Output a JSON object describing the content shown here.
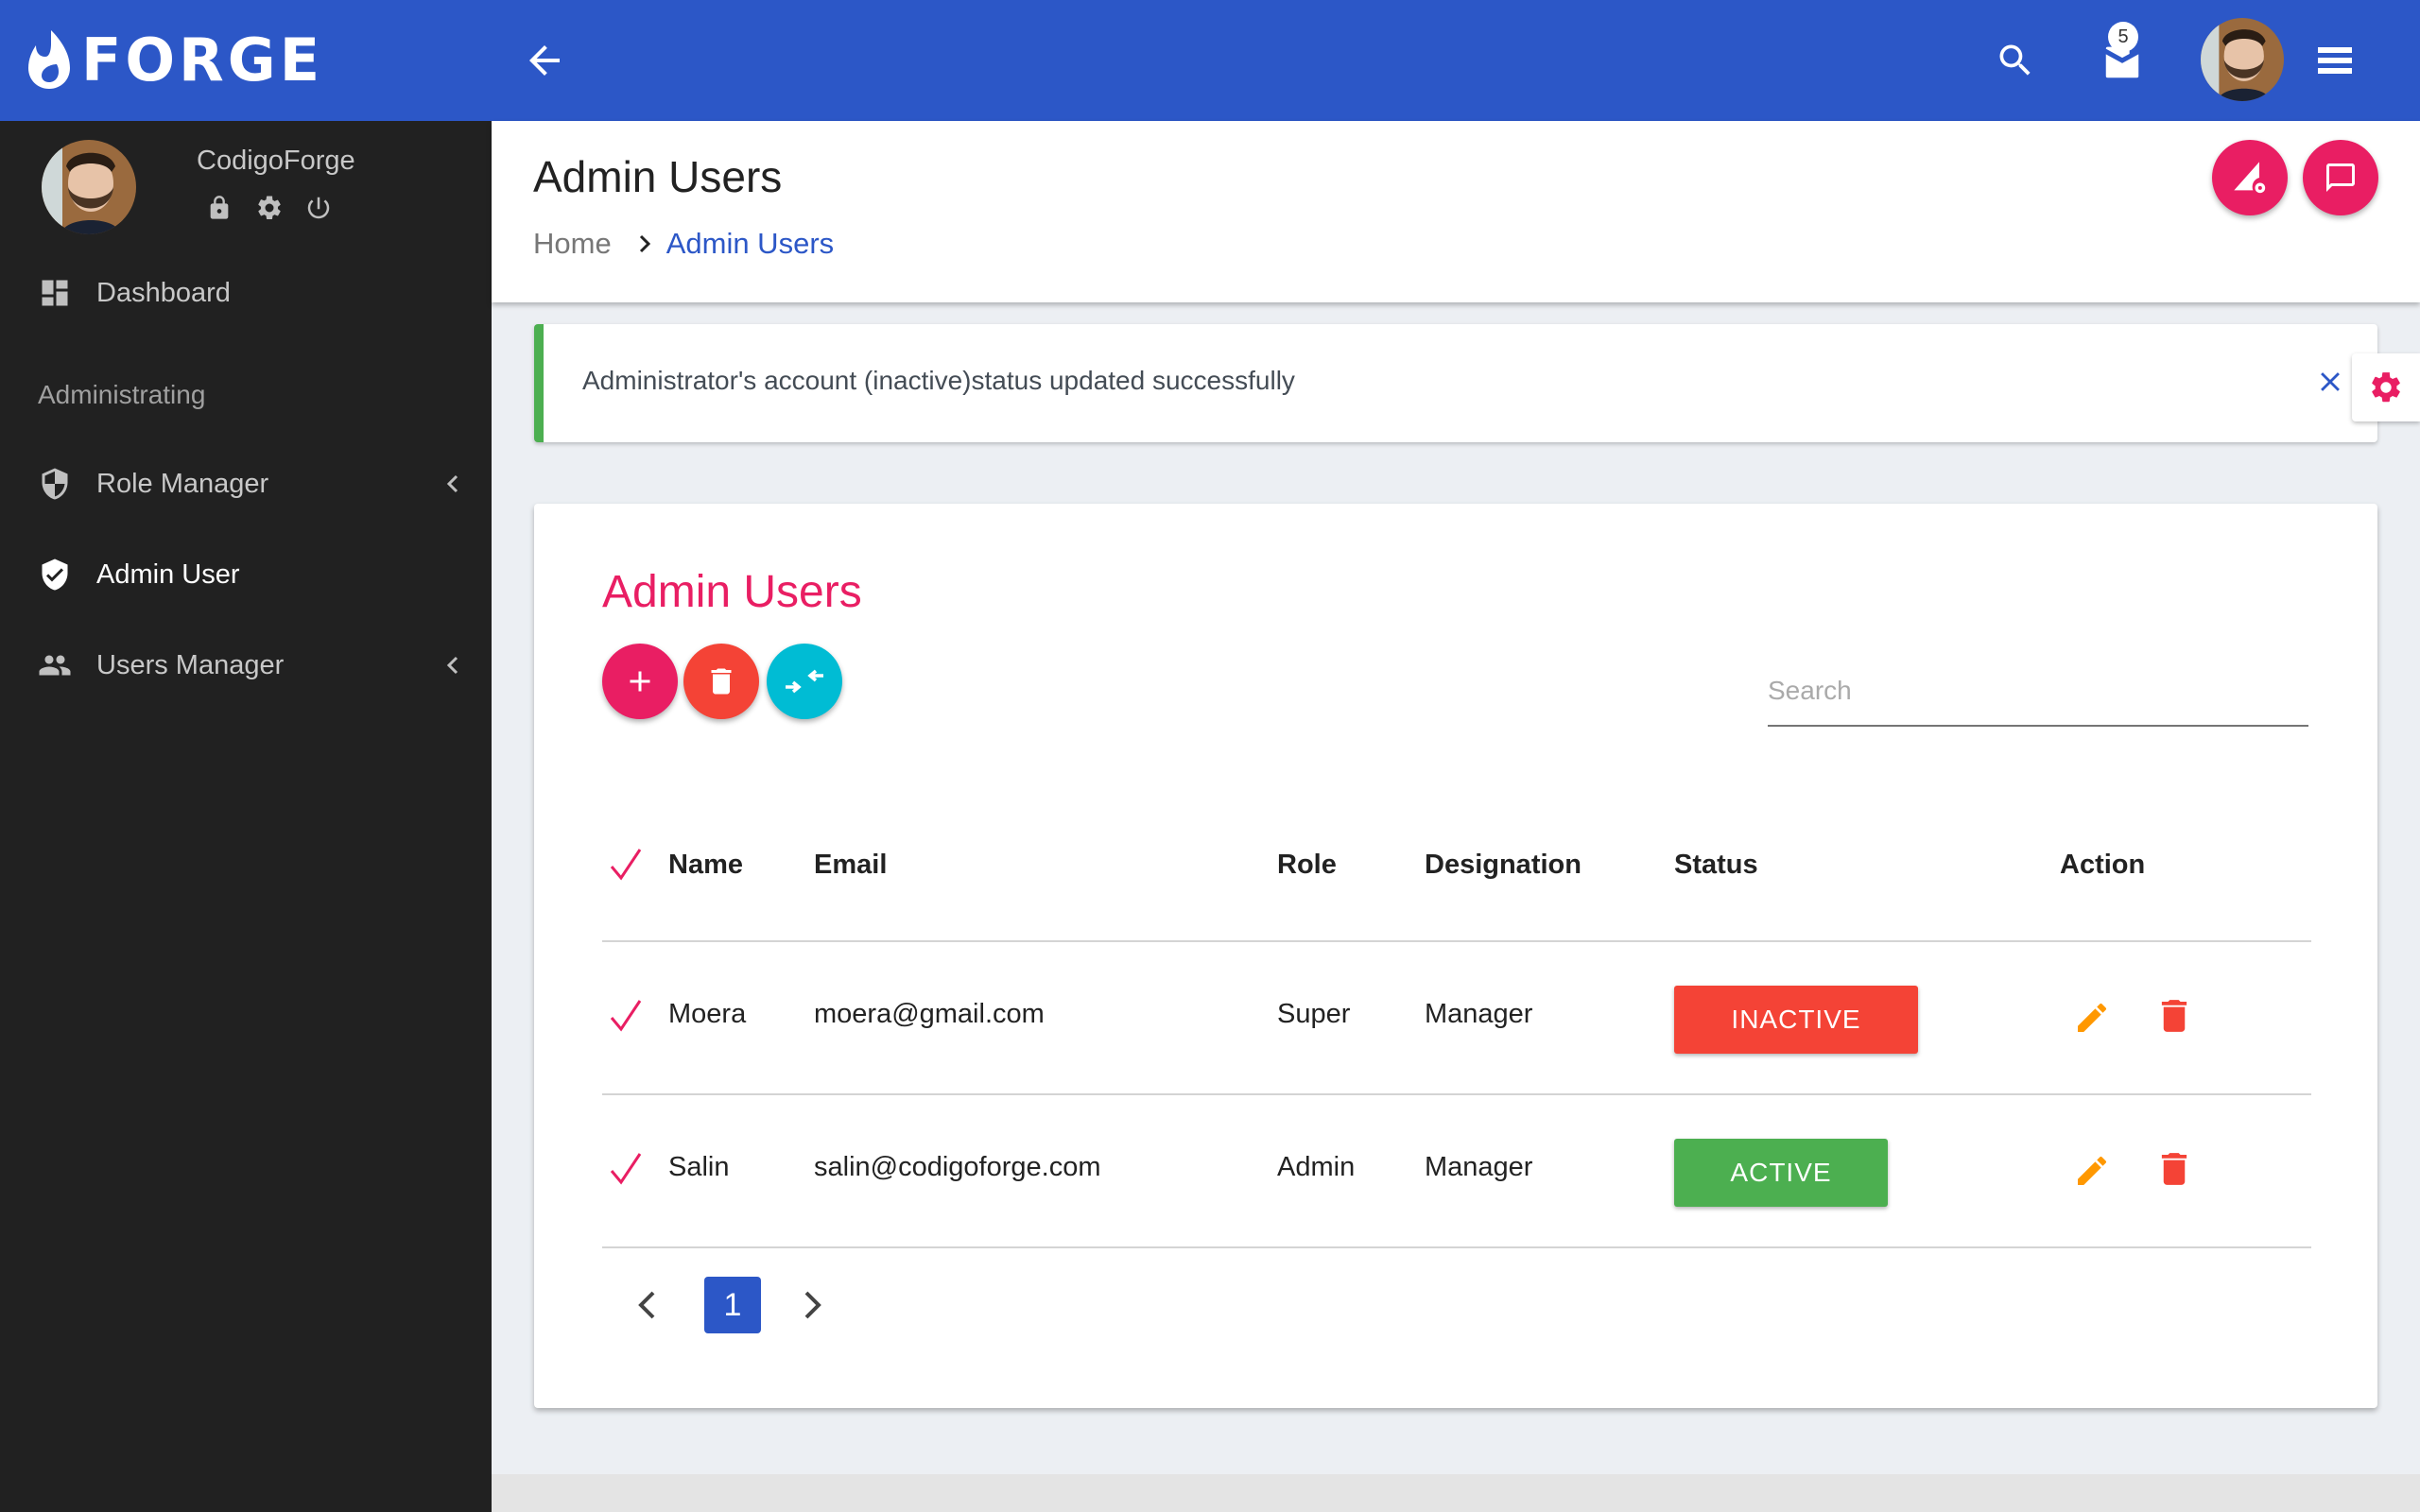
{
  "app": {
    "brand": "FORGE"
  },
  "topbar": {
    "mail_badge_count": "5",
    "icons": [
      "back-arrow-icon",
      "search-icon",
      "mail-icon",
      "avatar",
      "menu-icon"
    ]
  },
  "sidebar": {
    "username": "CodigoForge",
    "user_actions": [
      "lock-icon",
      "gear-icon",
      "power-icon"
    ],
    "section_label": "Administrating",
    "items": [
      {
        "label": "Dashboard",
        "icon": "dashboard-icon",
        "active": false,
        "has_submenu": false
      },
      {
        "label": "Role Manager",
        "icon": "shield-half-icon",
        "active": false,
        "has_submenu": true
      },
      {
        "label": "Admin User",
        "icon": "shield-check-icon",
        "active": true,
        "has_submenu": false
      },
      {
        "label": "Users Manager",
        "icon": "people-icon",
        "active": false,
        "has_submenu": true
      }
    ]
  },
  "page_header": {
    "title": "Admin Users",
    "breadcrumb": {
      "home": "Home",
      "current": "Admin Users"
    }
  },
  "alert": {
    "message": "Administrator's account (inactive)status updated successfully",
    "type": "success"
  },
  "card": {
    "title": "Admin Users",
    "search": {
      "placeholder": "Search",
      "value": ""
    },
    "table": {
      "columns": [
        "Name",
        "Email",
        "Role",
        "Designation",
        "Status",
        "Action"
      ],
      "rows": [
        {
          "name": "Moera",
          "email": "moera@gmail.com",
          "role": "Super",
          "designation": "Manager",
          "status": "INACTIVE"
        },
        {
          "name": "Salin",
          "email": "salin@codigoforge.com",
          "role": "Admin",
          "designation": "Manager",
          "status": "ACTIVE"
        }
      ]
    },
    "pagination": {
      "current_page": "1"
    }
  },
  "colors": {
    "primary": "#2C57C7",
    "accent": "#E91E63",
    "danger": "#F44336",
    "success": "#4CAF50",
    "info": "#00BCD4",
    "warning": "#FF9800",
    "sidebar_bg": "#212121"
  }
}
